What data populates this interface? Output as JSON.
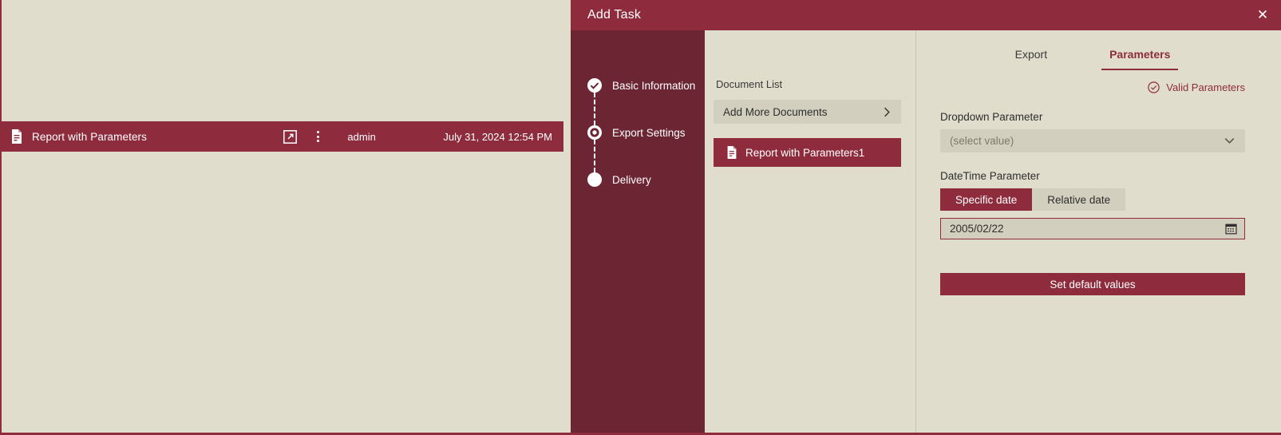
{
  "app": {
    "report_row": {
      "doc_icon": "document-icon",
      "title": "Report with Parameters",
      "open_icon": "open-external-icon",
      "menu_icon": "kebab-menu-icon",
      "user": "admin",
      "timestamp": "July 31, 2024 12:54 PM"
    }
  },
  "dialog": {
    "title": "Add Task",
    "close_icon": "close-icon",
    "close_label": "✕",
    "stepper": {
      "items": [
        {
          "label": "Basic Information",
          "state": "completed",
          "icon": "check-circle-icon"
        },
        {
          "label": "Export Settings",
          "state": "current",
          "icon": "radio-selected-icon"
        },
        {
          "label": "Delivery",
          "state": "pending",
          "icon": "filled-circle-icon"
        }
      ]
    },
    "document_list": {
      "heading": "Document List",
      "add_button": {
        "label": "Add More Documents",
        "chevron_icon": "chevron-right-icon"
      },
      "items": [
        {
          "label": "Report with Parameters1",
          "icon": "document-icon",
          "selected": true
        }
      ]
    },
    "parameters_panel": {
      "tabs": [
        {
          "label": "Export",
          "active": false
        },
        {
          "label": "Parameters",
          "active": true
        }
      ],
      "validity": {
        "text": "Valid Parameters",
        "icon": "check-circle-outline-icon"
      },
      "dropdown_parameter": {
        "label": "Dropdown Parameter",
        "value": "(select value)",
        "placeholder": "(select value)",
        "chevron_icon": "chevron-down-icon"
      },
      "datetime_parameter": {
        "label": "DateTime Parameter",
        "modes": [
          {
            "label": "Specific date",
            "active": true
          },
          {
            "label": "Relative date",
            "active": false
          }
        ],
        "value": "2005/02/22",
        "calendar_icon": "calendar-icon"
      },
      "set_defaults_button": "Set default values"
    }
  },
  "colors": {
    "accent": "#8e2c3e",
    "accent_dark": "#6b2533",
    "surface": "#e0ddcc",
    "control": "#d2cfbe",
    "text": "#2e2e2e"
  }
}
